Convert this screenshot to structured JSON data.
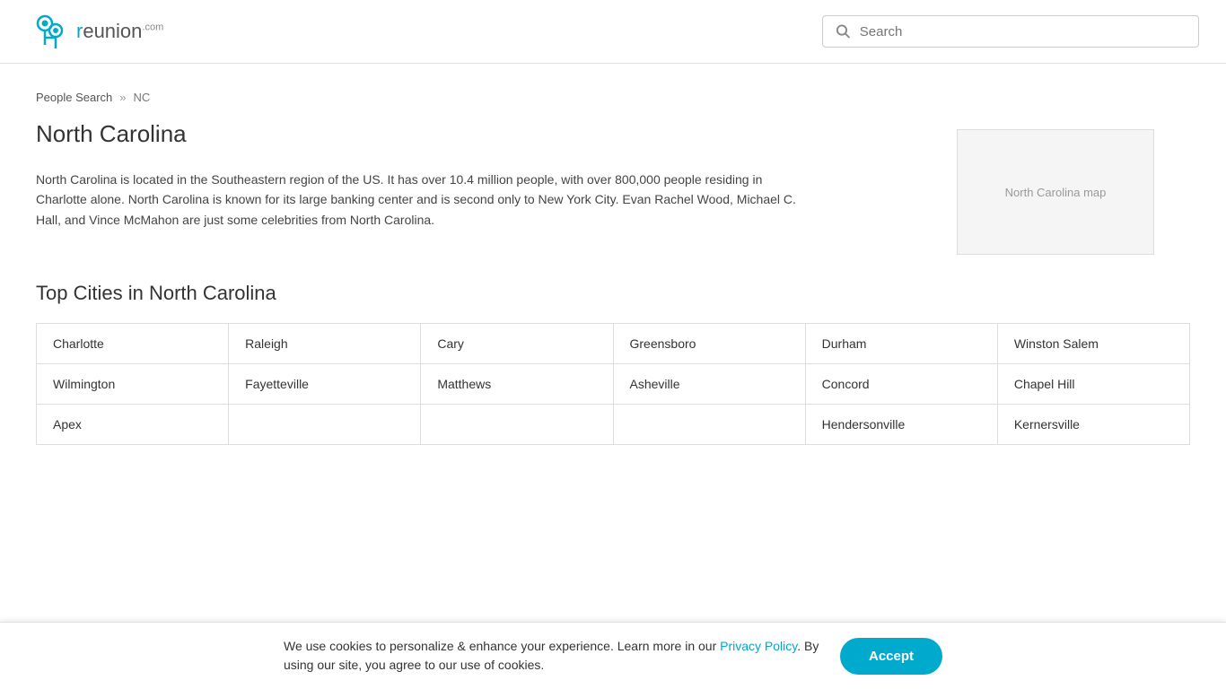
{
  "header": {
    "logo_text": "reunion",
    "logo_suffix": ".com",
    "search_placeholder": "Search"
  },
  "breadcrumb": {
    "people_search": "People Search",
    "separator": "»",
    "state_abbr": "NC"
  },
  "page": {
    "title": "North Carolina",
    "description": "North Carolina is located in the Southeastern region of the US. It has over 10.4 million people, with over 800,000 people residing in Charlotte alone. North Carolina is known for its large banking center and is second only to New York City. Evan Rachel Wood, Michael C. Hall, and Vince McMahon are just some celebrities from North Carolina.",
    "map_alt": "North Carolina map"
  },
  "cities_section": {
    "title": "Top Cities in North Carolina",
    "cities": [
      "Charlotte",
      "Raleigh",
      "Cary",
      "Greensboro",
      "Durham",
      "Winston Salem",
      "Wilmington",
      "Fayetteville",
      "Matthews",
      "Asheville",
      "Concord",
      "Chapel Hill",
      "Apex",
      "",
      "",
      "",
      "Hendersonville",
      "Kernersville"
    ]
  },
  "cookie_banner": {
    "text_before_link": "We use cookies to personalize & enhance your experience. Learn more in our ",
    "link_text": "Privacy Policy",
    "text_after_link": ". By using our site, you agree to our use of cookies.",
    "accept_button": "Accept"
  }
}
